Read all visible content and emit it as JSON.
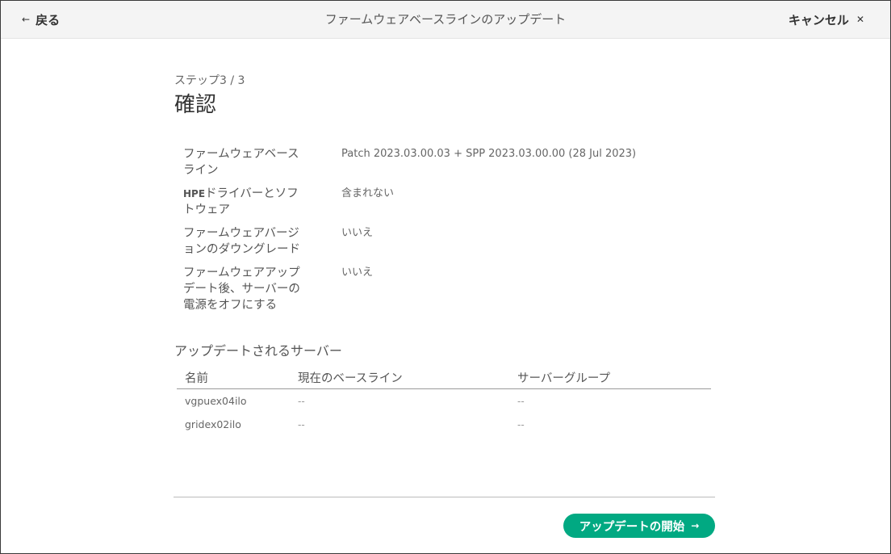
{
  "header": {
    "back_label": "戻る",
    "title": "ファームウェアベースラインのアップデート",
    "cancel_label": "キャンセル"
  },
  "step": {
    "label": "ステップ3 / 3",
    "title": "確認"
  },
  "summary": {
    "rows": [
      {
        "label_lines": [
          "ファームウェアベース",
          "ライン"
        ],
        "value": "Patch 2023.03.00.03 + SPP 2023.03.00.00 (28 Jul 2023)"
      },
      {
        "label_prefix": "HPE",
        "label_lines": [
          "ドライバーとソフ",
          "トウェア"
        ],
        "value": "含まれない"
      },
      {
        "label_lines": [
          "ファームウェアバージ",
          "ョンのダウングレード"
        ],
        "value": "いいえ"
      },
      {
        "label_lines": [
          "ファームウェアアップ",
          "デート後、サーバーの",
          "電源をオフにする"
        ],
        "value": "いいえ"
      }
    ]
  },
  "servers": {
    "section_title": "アップデートされるサーバー",
    "columns": [
      "名前",
      "現在のベースライン",
      "サーバーグループ"
    ],
    "rows": [
      {
        "name": "vgpuex04ilo",
        "baseline": "--",
        "group": "--"
      },
      {
        "name": "gridex02ilo",
        "baseline": "--",
        "group": "--"
      }
    ]
  },
  "footer": {
    "start_label": "アップデートの開始"
  },
  "colors": {
    "accent": "#01a982"
  },
  "icons": {
    "back": "arrow-left-icon",
    "cancel": "close-icon",
    "start": "arrow-right-icon"
  }
}
